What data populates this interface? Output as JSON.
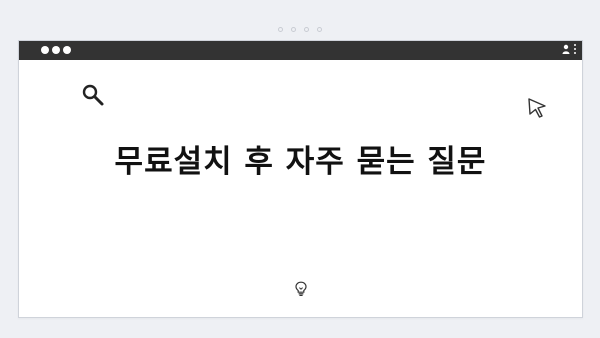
{
  "window": {
    "headline": "무료설치 후 자주 묻는 질문"
  },
  "icons": {
    "top": "pager-dots-icon",
    "search": "search-icon",
    "cursor": "cursor-arrow-icon",
    "bulb": "lightbulb-icon",
    "user": "user-icon",
    "menu": "kebab-menu-icon"
  },
  "colors": {
    "page_background": "#eef0f4",
    "window_background": "#ffffff",
    "titlebar": "#333333",
    "headline": "#111111"
  }
}
